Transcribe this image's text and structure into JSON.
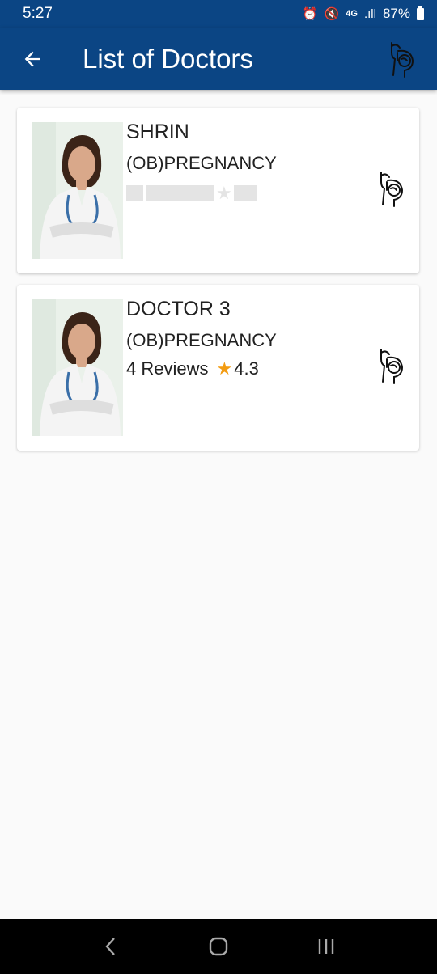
{
  "status_bar": {
    "time": "5:27",
    "network": "4G",
    "battery": "87%"
  },
  "app_bar": {
    "title": "List of Doctors",
    "back_icon": "arrow-left-icon",
    "logo_icon": "pregnancy-icon"
  },
  "doctors": [
    {
      "name": "SHRIN",
      "specialty": "(OB)PREGNANCY",
      "reviews": null,
      "rating": null,
      "loading_rating": true,
      "specialty_icon": "pregnancy-icon"
    },
    {
      "name": "DOCTOR 3",
      "specialty": "(OB)PREGNANCY",
      "reviews": "4 Reviews",
      "rating": "4.3",
      "loading_rating": false,
      "specialty_icon": "pregnancy-icon"
    }
  ],
  "colors": {
    "primary": "#0b4584",
    "star": "#f39c12",
    "skeleton": "#e4e4e4",
    "background": "#fafafa"
  },
  "nav_bar": {
    "icons": [
      "back-nav-icon",
      "home-nav-icon",
      "recents-nav-icon"
    ]
  }
}
